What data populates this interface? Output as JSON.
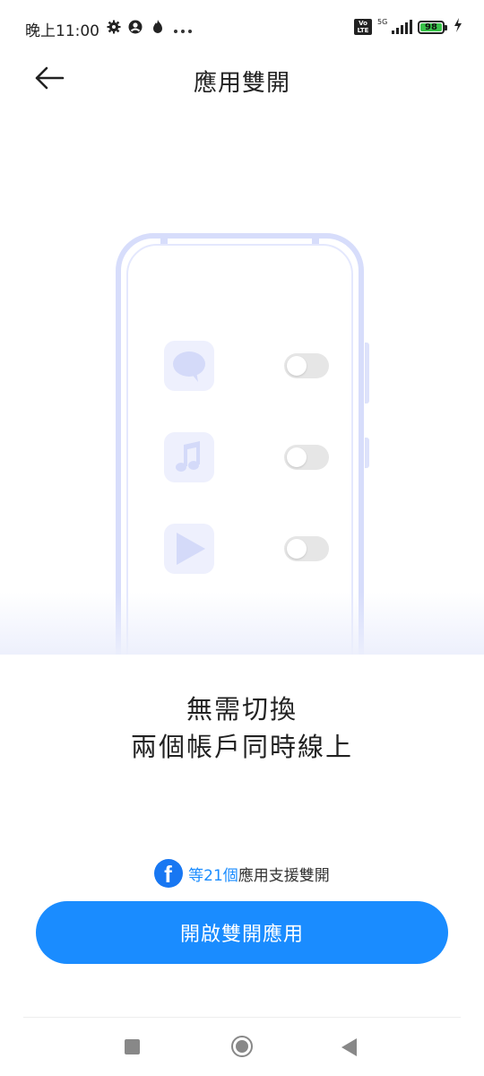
{
  "status_bar": {
    "time": "晚上11:00",
    "left_icons": [
      "gear-icon",
      "account-icon",
      "flame-icon",
      "more-icon"
    ],
    "network_label": "5G",
    "volte_label": "Vo LTE",
    "battery_level": "98",
    "charging": true
  },
  "header": {
    "title": "應用雙開",
    "back_icon": "arrow-left-icon"
  },
  "illustration": {
    "apps": [
      {
        "icon": "chat-bubble-icon",
        "toggle": "off"
      },
      {
        "icon": "music-note-icon",
        "toggle": "off"
      },
      {
        "icon": "play-icon",
        "toggle": "off"
      }
    ]
  },
  "tagline": {
    "line1": "無需切換",
    "line2": "兩個帳戶同時線上"
  },
  "support": {
    "app_icon": "facebook-icon",
    "count_text": "等21個",
    "rest_text": "應用支援雙開"
  },
  "cta": {
    "label": "開啟雙開應用"
  },
  "colors": {
    "accent": "#1a8cff",
    "battery": "#39c24a",
    "phone_outline": "#d7ddfb"
  },
  "nav_bar": {
    "recent_icon": "square-recent-icon",
    "home_icon": "circle-home-icon",
    "back_icon": "triangle-back-icon"
  }
}
